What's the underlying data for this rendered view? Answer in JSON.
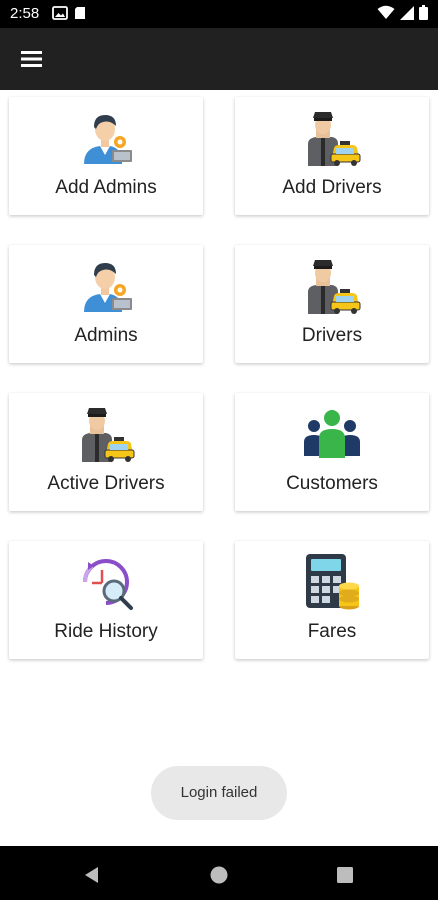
{
  "status_bar": {
    "time": "2:58"
  },
  "menu": [
    {
      "id": "add-admins",
      "label": "Add Admins",
      "icon": "admin-person-icon"
    },
    {
      "id": "add-drivers",
      "label": "Add Drivers",
      "icon": "driver-taxi-icon"
    },
    {
      "id": "admins",
      "label": "Admins",
      "icon": "admin-person-icon"
    },
    {
      "id": "drivers",
      "label": "Drivers",
      "icon": "driver-taxi-icon"
    },
    {
      "id": "active-drivers",
      "label": "Active Drivers",
      "icon": "driver-taxi-icon"
    },
    {
      "id": "customers",
      "label": "Customers",
      "icon": "customers-group-icon"
    },
    {
      "id": "ride-history",
      "label": "Ride History",
      "icon": "ride-history-icon"
    },
    {
      "id": "fares",
      "label": "Fares",
      "icon": "fares-calculator-icon"
    }
  ],
  "toast": {
    "message": "Login failed"
  },
  "colors": {
    "app_bar": "#212121",
    "status_bar": "#000000",
    "accent_yellow": "#f5c518",
    "customers_green": "#39b54a",
    "customers_navy": "#1f3a66",
    "history_purple": "#8a4fc8"
  }
}
